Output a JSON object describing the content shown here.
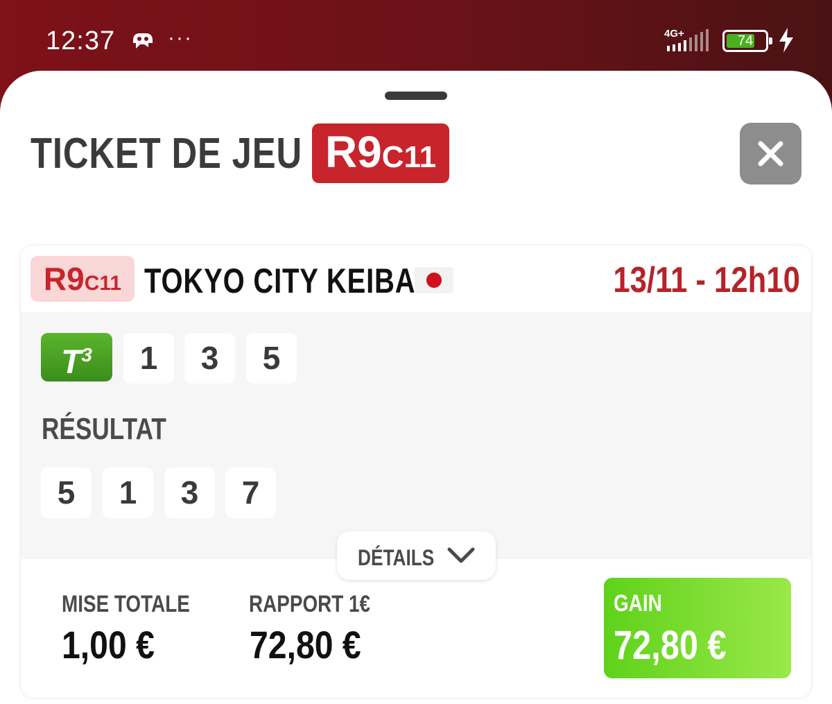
{
  "status_bar": {
    "time": "12:37",
    "more": "···",
    "network": "4G+",
    "battery_level": "74",
    "battery_fraction": 0.74,
    "notification_icon": "drone-icon",
    "charge_icon": "bolt-icon"
  },
  "sheet": {
    "title": "TICKET DE JEU",
    "race_badge": {
      "reunion": "R9",
      "course": "C11"
    },
    "close_icon": "close-icon"
  },
  "ticket": {
    "race_badge": {
      "reunion": "R9",
      "course": "C11"
    },
    "track": "TOKYO CITY KEIBA",
    "flag": "japan-flag",
    "date_time": "13/11 - 12h10",
    "bet_type": {
      "letter": "T",
      "sup": "3"
    },
    "selection": [
      "1",
      "3",
      "5"
    ],
    "result_label": "RÉSULTAT",
    "result": [
      "5",
      "1",
      "3",
      "7"
    ],
    "details_label": "DÉTAILS",
    "mise_label": "MISE TOTALE",
    "mise_value": "1,00 €",
    "rapport_label": "RAPPORT 1€",
    "rapport_value": "72,80 €",
    "gain_label": "GAIN",
    "gain_value": "72,80 €"
  },
  "colors": {
    "brand_red": "#c8242c",
    "header_bg": "#7e1119",
    "gain_green": "#5fd21a",
    "bet_green": "#4aa424"
  }
}
